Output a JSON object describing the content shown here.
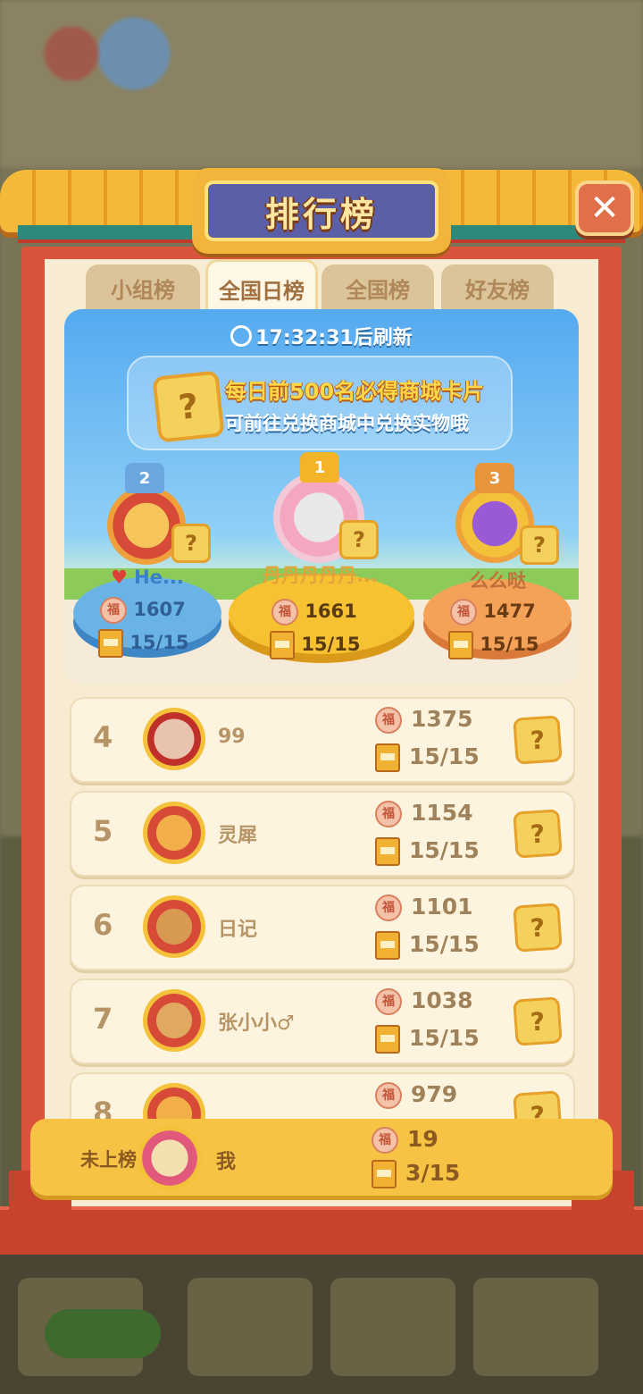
{
  "window": {
    "title": "排行榜",
    "close_label": "✕"
  },
  "tabs": [
    {
      "label": "小组榜",
      "active": false
    },
    {
      "label": "全国日榜",
      "active": true
    },
    {
      "label": "全国榜",
      "active": false
    },
    {
      "label": "好友榜",
      "active": false
    }
  ],
  "header": {
    "refresh_text": "17:32:31后刷新",
    "promo_line1": "每日前500名必得商城卡片",
    "promo_line2": "可前往兑换商城中兑换实物哦",
    "card_symbol": "?"
  },
  "podium": [
    {
      "rank": "2",
      "name": "He...",
      "score": "1607",
      "books": "15/15"
    },
    {
      "rank": "1",
      "name": "丹丹丹丹丹...",
      "score": "1661",
      "books": "15/15"
    },
    {
      "rank": "3",
      "name": "么么哒",
      "score": "1477",
      "books": "15/15"
    }
  ],
  "ranking": [
    {
      "rank": "4",
      "name": "99",
      "score": "1375",
      "books": "15/15"
    },
    {
      "rank": "5",
      "name": "灵犀",
      "score": "1154",
      "books": "15/15"
    },
    {
      "rank": "6",
      "name": "日记",
      "score": "1101",
      "books": "15/15"
    },
    {
      "rank": "7",
      "name": "张小小♂",
      "score": "1038",
      "books": "15/15"
    },
    {
      "rank": "8",
      "name": "",
      "score": "979",
      "books": ""
    }
  ],
  "me": {
    "rank_label": "未上榜",
    "name": "我",
    "score": "19",
    "books": "3/15"
  },
  "icons": {
    "fu": "福",
    "question": "?"
  },
  "colors": {
    "accent": "#f7c344",
    "frame": "#d9543a",
    "title_plate": "#5a5fa8"
  }
}
